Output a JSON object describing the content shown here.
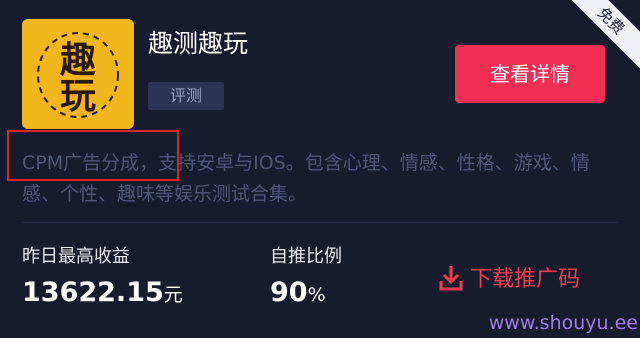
{
  "app": {
    "logo_text_top": "趣",
    "logo_text_bottom": "玩",
    "title": "趣测趣玩",
    "tag": "评测",
    "view_button_label": "查看详情",
    "ribbon_label": "免费"
  },
  "description": {
    "highlight": "CPM广告分成",
    "rest": "，支持安卓与IOS。包含心理、情感、性格、游戏、情感、个性、趣味等娱乐测试合集。"
  },
  "stats": {
    "earnings_label": "昨日最高收益",
    "earnings_value": "13622.15",
    "earnings_unit": "元",
    "ratio_label": "自推比例",
    "ratio_value": "90",
    "ratio_unit": "%"
  },
  "download": {
    "label": "下载推广码",
    "icon": "download-icon"
  },
  "watermark": "www.shouyu.ee",
  "colors": {
    "background": "#161b2e",
    "accent": "#f12e53",
    "logo_bg": "#f4b61d",
    "highlight_border": "#e02525",
    "watermark": "#a37be6"
  }
}
